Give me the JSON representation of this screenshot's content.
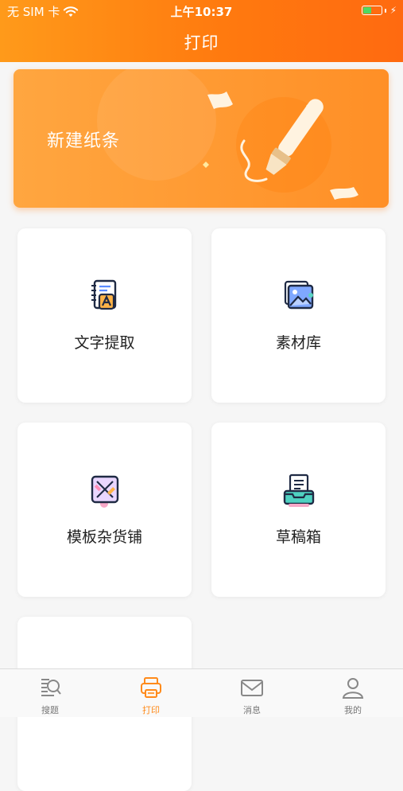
{
  "status_bar": {
    "carrier": "无 SIM 卡",
    "time": "上午10:37",
    "battery_level": 0.45
  },
  "header": {
    "title": "打印"
  },
  "banner": {
    "label": "新建纸条"
  },
  "grid": [
    {
      "label": "文字提取",
      "icon": "text-extract-icon"
    },
    {
      "label": "素材库",
      "icon": "image-library-icon"
    },
    {
      "label": "模板杂货铺",
      "icon": "template-shop-icon"
    },
    {
      "label": "草稿箱",
      "icon": "draft-box-icon"
    }
  ],
  "tabbar": {
    "items": [
      {
        "label": "搜题",
        "icon": "search-question-icon",
        "active": false
      },
      {
        "label": "打印",
        "icon": "printer-icon",
        "active": true
      },
      {
        "label": "消息",
        "icon": "mail-icon",
        "active": false
      },
      {
        "label": "我的",
        "icon": "user-icon",
        "active": false
      }
    ]
  },
  "colors": {
    "accent": "#FF8A1A",
    "header_start": "#FF9A1A",
    "header_end": "#FF6A10"
  }
}
